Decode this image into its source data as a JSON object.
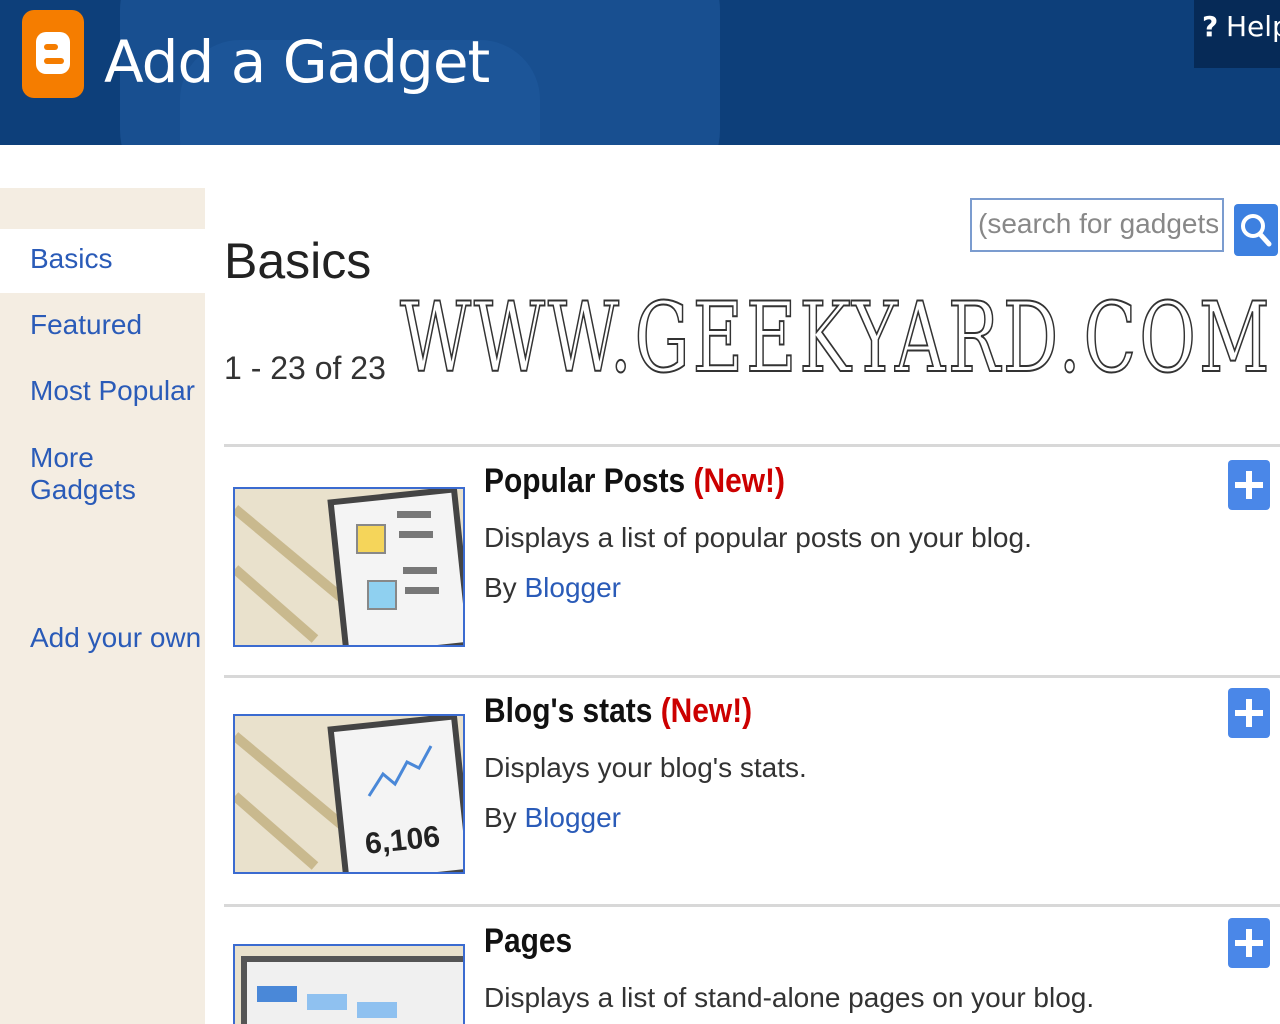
{
  "header": {
    "title": "Add a Gadget",
    "help_label": "Help",
    "help_icon_text": "?"
  },
  "sidebar": {
    "items": [
      {
        "label": "Basics"
      },
      {
        "label": "Featured"
      },
      {
        "label": "Most Popular"
      },
      {
        "label": "More Gadgets"
      }
    ],
    "add_own": "Add your own"
  },
  "main": {
    "heading": "Basics",
    "count": "1 - 23 of 23",
    "search_placeholder": "(search for gadgets)"
  },
  "watermark": "WWW.GEEKYARD.COM",
  "gadgets": [
    {
      "title": "Popular Posts",
      "badge": "(New!)",
      "description": "Displays a list of popular posts on your blog.",
      "by_label": "By",
      "author": "Blogger"
    },
    {
      "title": "Blog's stats",
      "badge": "(New!)",
      "description": "Displays your blog's stats.",
      "by_label": "By",
      "author": "Blogger",
      "thumb_number": "6,106"
    },
    {
      "title": "Pages",
      "description": "Displays a list of stand-alone pages on your blog."
    }
  ],
  "colors": {
    "header": "#0d3f7a",
    "link": "#2a5bb8",
    "new_badge": "#cc0000",
    "sidebar": "#f4ede2",
    "logo": "#f57d00"
  }
}
